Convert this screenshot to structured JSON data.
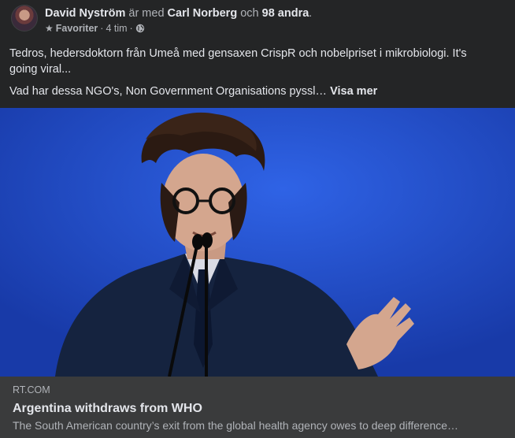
{
  "header": {
    "author": "David Nyström",
    "with_word": "är med",
    "tagged": "Carl Norberg",
    "and_word": "och",
    "others": "98 andra",
    "period": ".",
    "audience": "Favoriter",
    "sep1": "·",
    "time": "4 tim",
    "sep2": "·",
    "star_icon": "star-icon",
    "privacy_icon": "globe-icon"
  },
  "body": {
    "paragraph1": "Tedros, hedersdoktorn från Umeå med gensaxen CrispR och nobelpriset i mikrobiologi. It's going viral...",
    "paragraph2": "Vad har dessa NGO's, Non Government Organisations pyssl…",
    "see_more": "Visa mer"
  },
  "link_preview": {
    "domain": "RT.COM",
    "title": "Argentina withdraws from WHO",
    "description": "The South American country’s exit from the global health agency owes to deep difference…"
  },
  "colors": {
    "background": "#242526",
    "preview_bg": "#3a3b3c",
    "photo_blue": "#1f4cc8",
    "text_primary": "#e4e6eb",
    "text_secondary": "#b0b3b8"
  }
}
